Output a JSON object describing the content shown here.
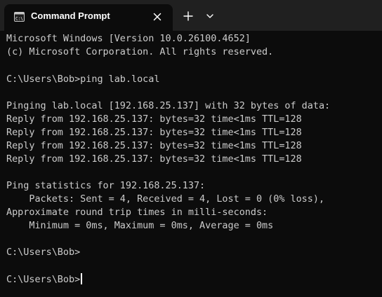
{
  "window": {
    "tab_title": "Command Prompt",
    "tab_icon": "cmd-icon",
    "close_icon": "close-icon",
    "new_tab_icon": "plus-icon",
    "dropdown_icon": "chevron-down-icon"
  },
  "terminal": {
    "lines": [
      "Microsoft Windows [Version 10.0.26100.4652]",
      "(c) Microsoft Corporation. All rights reserved.",
      "",
      "C:\\Users\\Bob>ping lab.local",
      "",
      "Pinging lab.local [192.168.25.137] with 32 bytes of data:",
      "Reply from 192.168.25.137: bytes=32 time<1ms TTL=128",
      "Reply from 192.168.25.137: bytes=32 time<1ms TTL=128",
      "Reply from 192.168.25.137: bytes=32 time<1ms TTL=128",
      "Reply from 192.168.25.137: bytes=32 time<1ms TTL=128",
      "",
      "Ping statistics for 192.168.25.137:",
      "    Packets: Sent = 4, Received = 4, Lost = 0 (0% loss),",
      "Approximate round trip times in milli-seconds:",
      "    Minimum = 0ms, Maximum = 0ms, Average = 0ms",
      "",
      "C:\\Users\\Bob>",
      "",
      "C:\\Users\\Bob>"
    ]
  }
}
